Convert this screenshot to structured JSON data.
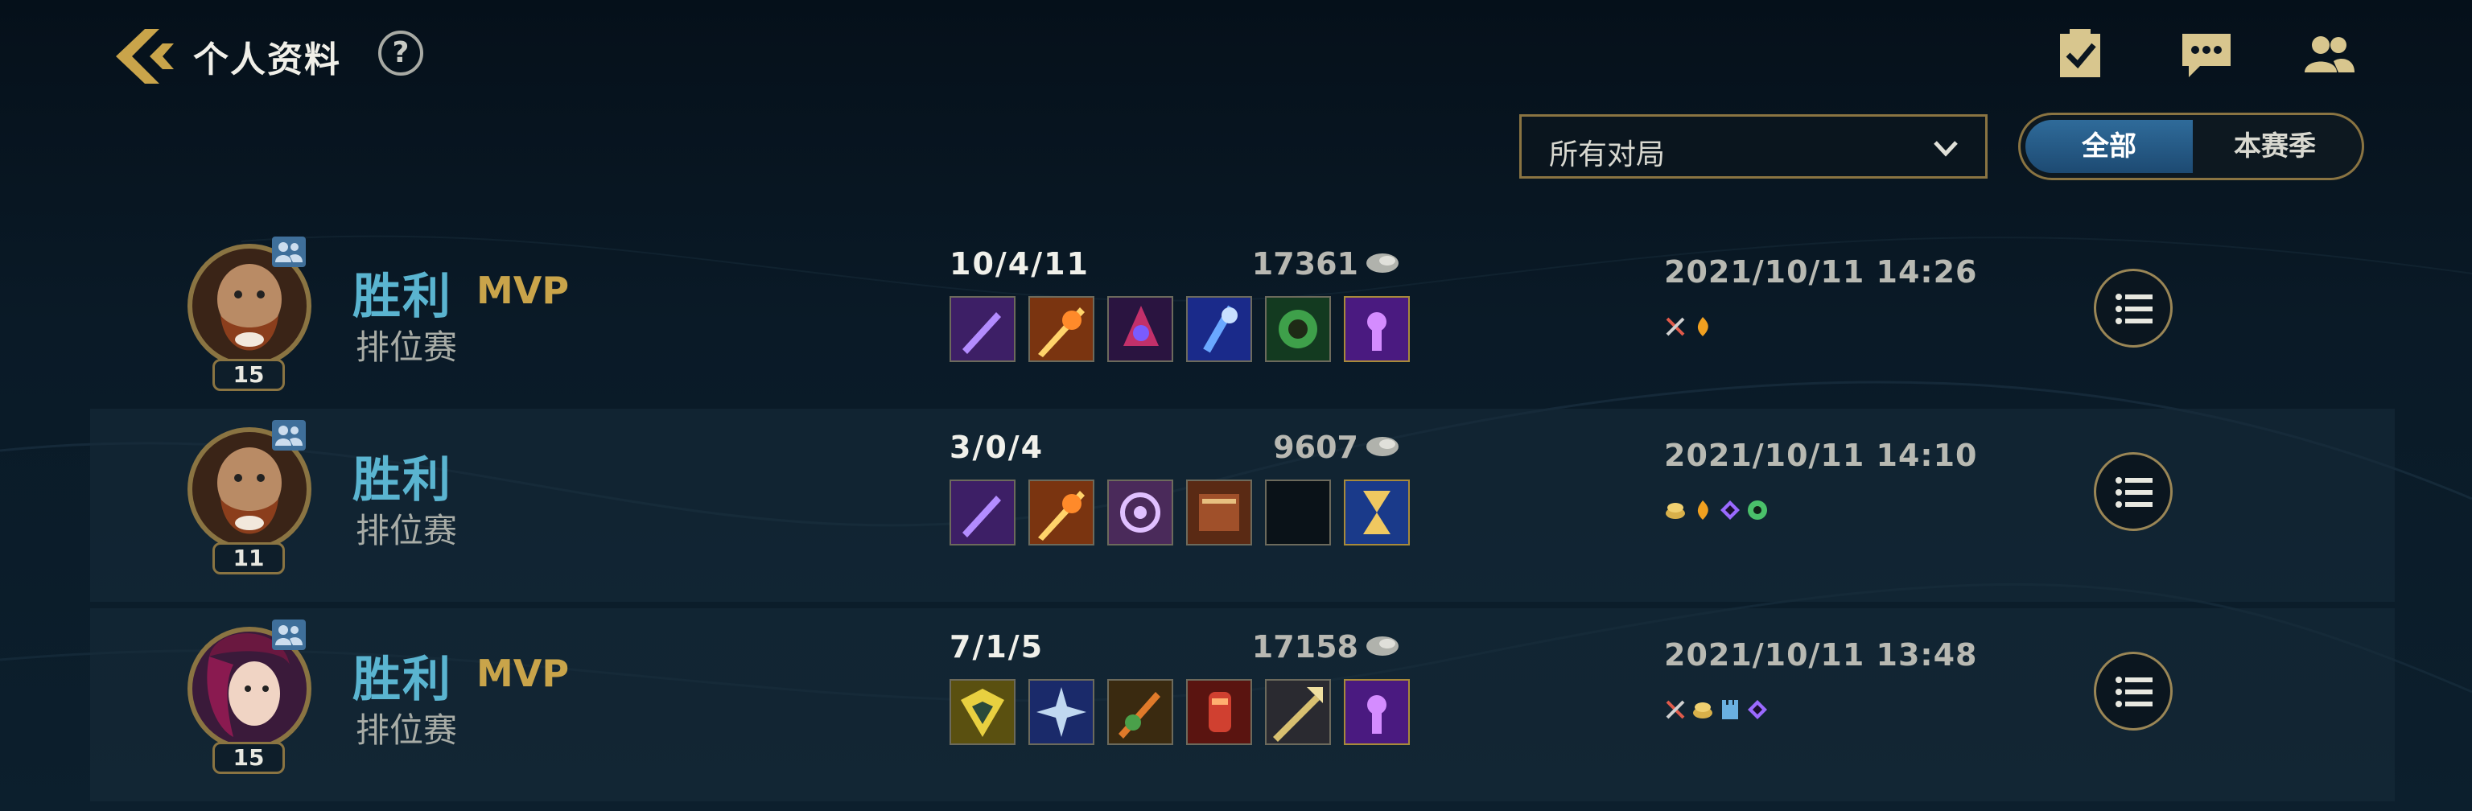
{
  "header": {
    "title": "个人资料",
    "help": "?",
    "icons": [
      "back-chevron-icon",
      "help-icon",
      "missions-clipboard-icon",
      "chat-icon",
      "friends-icon"
    ]
  },
  "filters": {
    "dropdown_value": "所有对局",
    "segment": {
      "options": [
        "全部",
        "本赛季"
      ],
      "selected": "全部"
    }
  },
  "colors": {
    "accent_gold": "#c9a44a",
    "win_blue": "#5ab4d0",
    "active_tab": "#2f6b9a"
  },
  "matches": [
    {
      "result": "胜利",
      "mvp": "MVP",
      "mode": "排位赛",
      "level": "15",
      "kda": "10/4/11",
      "gold": "17361",
      "datetime": "2021/10/11 14:26",
      "champion": "bearded-warrior",
      "items": [
        "purple-blade",
        "flame-sword",
        "void-mask",
        "arcane-staff",
        "green-orb",
        "purple-trinket"
      ],
      "tags": [
        "sword-tag-icon",
        "fire-tag-icon"
      ]
    },
    {
      "result": "胜利",
      "mvp": "",
      "mode": "排位赛",
      "level": "11",
      "kda": "3/0/4",
      "gold": "9607",
      "datetime": "2021/10/11 14:10",
      "champion": "bearded-warrior",
      "items": [
        "purple-blade",
        "flame-sword",
        "crest-shield",
        "tome",
        "empty",
        "hourglass-trinket"
      ],
      "tags": [
        "gold-tag-icon",
        "fire-tag-icon",
        "purple-gem-tag-icon",
        "green-ward-tag-icon"
      ]
    },
    {
      "result": "胜利",
      "mvp": "MVP",
      "mode": "排位赛",
      "level": "15",
      "kda": "7/1/5",
      "gold": "17158",
      "datetime": "2021/10/11 13:48",
      "champion": "duelist",
      "items": [
        "gold-shield",
        "steel-shuriken",
        "emerald-blade",
        "crimson-gauntlet",
        "gold-spear",
        "purple-trinket"
      ],
      "tags": [
        "sword-tag-icon",
        "gold-tag-icon",
        "tower-tag-icon",
        "purple-gem-tag-icon"
      ]
    }
  ]
}
